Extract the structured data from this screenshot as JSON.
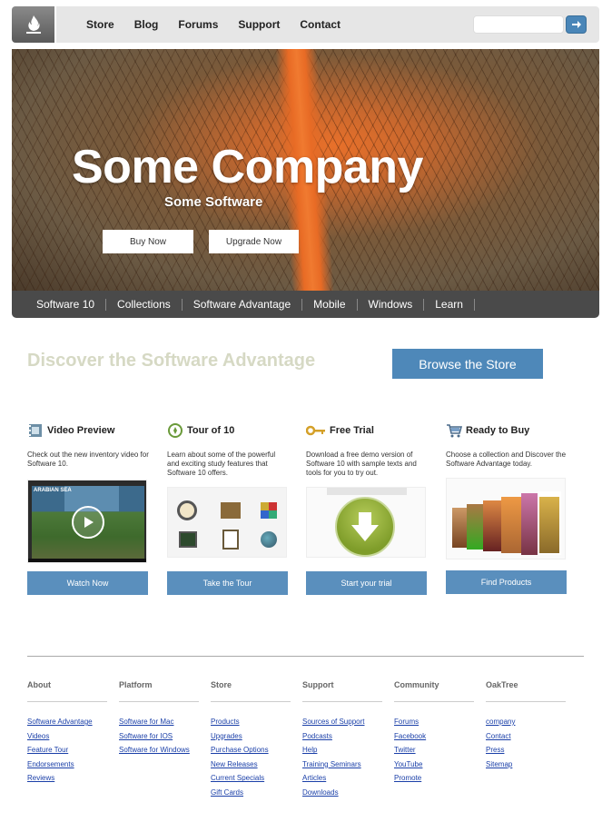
{
  "header": {
    "nav": [
      "Store",
      "Blog",
      "Forums",
      "Support",
      "Contact"
    ],
    "search": {
      "value": "",
      "placeholder": ""
    }
  },
  "hero": {
    "title": "Some Company",
    "subtitle": "Some Software",
    "buy_label": "Buy Now",
    "upgrade_label": "Upgrade Now"
  },
  "subnav": [
    "Software 10",
    "Collections",
    "Software Advantage",
    "Mobile",
    "Windows",
    "Learn"
  ],
  "discover": {
    "heading": "Discover the Software Advantage",
    "button": "Browse the Store"
  },
  "features": [
    {
      "icon": "film-icon",
      "title": "Video Preview",
      "desc": "Check out the new inventory video for Software 10.",
      "button": "Watch Now"
    },
    {
      "icon": "compass-icon",
      "title": "Tour of 10",
      "desc": "Learn about some of the powerful and exciting study features that Software 10 offers.",
      "button": "Take the Tour"
    },
    {
      "icon": "key-icon",
      "title": "Free Trial",
      "desc": "Download a free demo version of Software 10 with sample texts and tools for you to try out.",
      "button": "Start your trial"
    },
    {
      "icon": "cart-icon",
      "title": "Ready to Buy",
      "desc": "Choose a collection and Discover the Software Advantage today.",
      "button": "Find Products"
    }
  ],
  "video_caption": "ARABIAN SEA",
  "footer": [
    {
      "heading": "About",
      "links": [
        "Software Advantage",
        "Videos",
        "Feature Tour",
        "Endorsements",
        "Reviews"
      ]
    },
    {
      "heading": "Platform",
      "links": [
        "Software for Mac",
        "Software for IOS",
        "Software for Windows"
      ]
    },
    {
      "heading": "Store",
      "links": [
        "Products",
        "Upgrades",
        "Purchase Options",
        "New Releases",
        "Current Specials",
        "Gift Cards"
      ]
    },
    {
      "heading": "Support",
      "links": [
        "Sources of Support",
        "Podcasts",
        "Help",
        "Training Seminars",
        "Articles",
        "Downloads"
      ]
    },
    {
      "heading": "Community",
      "links": [
        "Forums",
        "Facebook",
        "Twitter",
        "YouTube",
        "Promote"
      ]
    },
    {
      "heading": "OakTree",
      "links": [
        "company",
        "Contact",
        "Press",
        "Sitemap"
      ]
    }
  ],
  "colors": {
    "accent": "#4e88b9",
    "button": "#5a8fbd",
    "subnav": "#4a4a4a",
    "discover": "#d6d9c4",
    "link": "#1a3fa8"
  }
}
